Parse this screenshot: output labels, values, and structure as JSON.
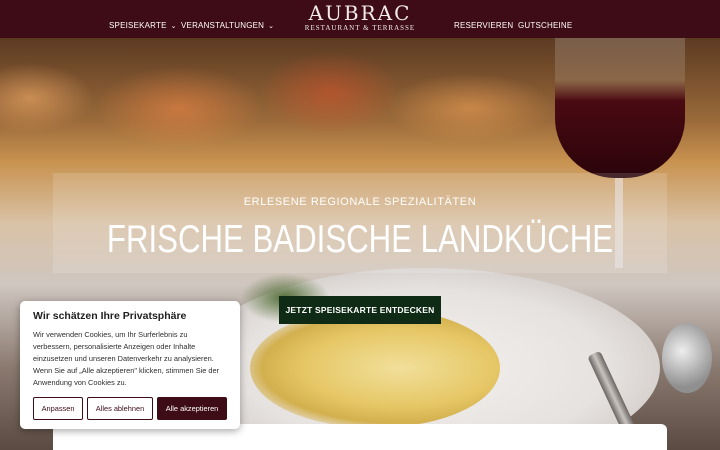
{
  "header": {
    "nav_left": [
      {
        "label": "SPEISEKARTE",
        "icon": "chevron-down-icon"
      },
      {
        "label": "VERANSTALTUNGEN",
        "icon": "chevron-down-icon"
      }
    ],
    "logo": {
      "name": "AUBRAC",
      "tagline": "RESTAURANT & TERRASSE"
    },
    "nav_right": [
      {
        "label": "RESERVIEREN"
      },
      {
        "label": "GUTSCHEINE"
      }
    ],
    "chevron_glyph": "⌄"
  },
  "hero": {
    "subtitle": "ERLESENE REGIONALE SPEZIALITÄTEN",
    "headline": "FRISCHE BADISCHE LANDKÜCHE",
    "cta_label": "JETZT SPEISEKARTE ENTDECKEN"
  },
  "cookie_banner": {
    "title": "Wir schätzen Ihre Privatsphäre",
    "text": "Wir verwenden Cookies, um Ihr Surferlebnis zu verbessern, personalisierte Anzeigen oder Inhalte einzusetzen und unseren Datenverkehr zu analysieren. Wenn Sie auf „Alle akzeptieren\" klicken, stimmen Sie der Anwendung von Cookies zu.",
    "buttons": {
      "customize": "Anpassen",
      "reject_all": "Alles ablehnen",
      "accept_all": "Alle akzeptieren"
    }
  },
  "colors": {
    "brand": "#3e0c17",
    "cta": "#0f2b16",
    "text_light": "#ffffff"
  }
}
